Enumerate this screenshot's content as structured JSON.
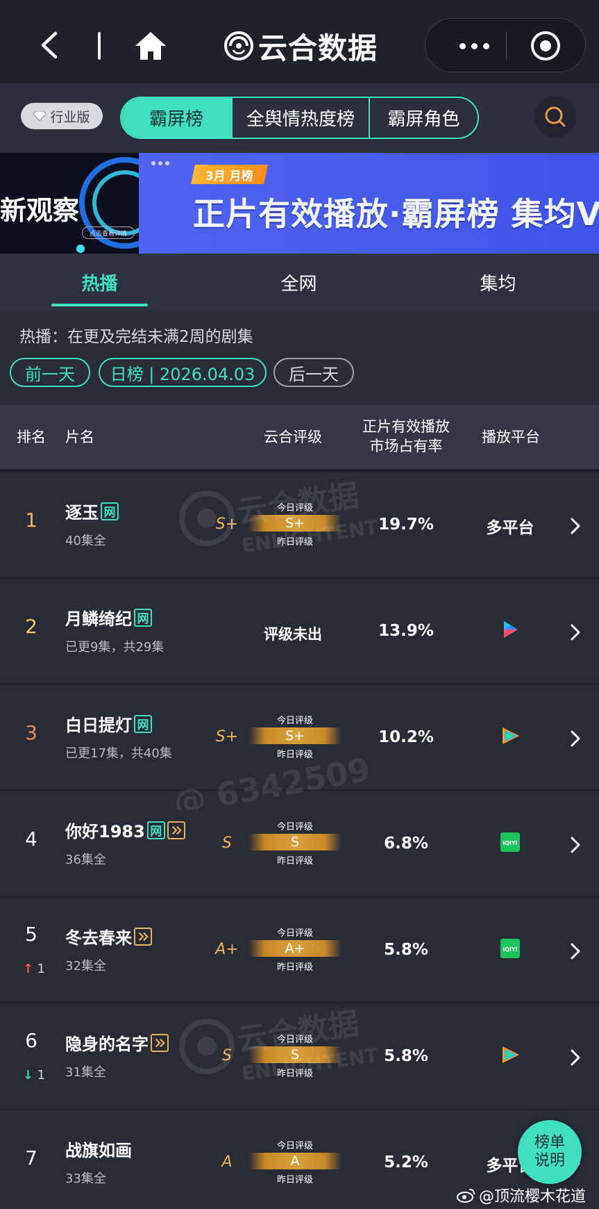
{
  "app": {
    "brand_name": "云合数据"
  },
  "nav": {
    "industry_label": "行业版",
    "segments": [
      "霸屏榜",
      "全舆情热度榜",
      "霸屏角色"
    ],
    "active_segment": 0
  },
  "banner": {
    "left_title": "新观察",
    "left_button": "点击查看详情",
    "tag": "3月 月榜",
    "title": "正片有效播放·霸屏榜 集均V"
  },
  "tabs": [
    "热播",
    "全网",
    "集均"
  ],
  "info": {
    "note": "热播：在更及完结未满2周的剧集",
    "prev_day": "前一天",
    "current_date": "日榜 | 2026.04.03",
    "next_day": "后一天"
  },
  "table": {
    "headers": {
      "rank": "排名",
      "title": "片名",
      "grade": "云合评级",
      "share_line1": "正片有效播放",
      "share_line2": "市场占有率",
      "platform": "播放平台"
    },
    "grade_today_label": "今日评级",
    "grade_yesterday_label": "昨日评级",
    "rows": [
      {
        "rank": "1",
        "title": "逐玉",
        "net": true,
        "play": false,
        "sub": "40集全",
        "grade": "S+",
        "today": "S+",
        "share": "19.7%",
        "platform": "多平台",
        "platform_icon": "",
        "change": "",
        "change_dir": ""
      },
      {
        "rank": "2",
        "title": "月鳞绮纪",
        "net": true,
        "play": false,
        "sub": "已更9集，共29集",
        "grade": "",
        "today": "",
        "grade_none": "评级未出",
        "share": "13.9%",
        "platform": "",
        "platform_icon": "youku-icon",
        "change": "",
        "change_dir": ""
      },
      {
        "rank": "3",
        "title": "白日提灯",
        "net": true,
        "play": false,
        "sub": "已更17集，共40集",
        "grade": "S+",
        "today": "S+",
        "share": "10.2%",
        "platform": "",
        "platform_icon": "tencent-video-icon",
        "change": "",
        "change_dir": ""
      },
      {
        "rank": "4",
        "title": "你好1983",
        "net": true,
        "play": true,
        "sub": "36集全",
        "grade": "S",
        "today": "S",
        "share": "6.8%",
        "platform": "",
        "platform_icon": "iqiyi-icon",
        "change": "",
        "change_dir": ""
      },
      {
        "rank": "5",
        "title": "冬去春来",
        "net": false,
        "play": true,
        "sub": "32集全",
        "grade": "A+",
        "today": "A+",
        "share": "5.8%",
        "platform": "",
        "platform_icon": "iqiyi-icon",
        "change": "1",
        "change_dir": "up"
      },
      {
        "rank": "6",
        "title": "隐身的名字",
        "net": false,
        "play": true,
        "sub": "31集全",
        "grade": "S",
        "today": "S",
        "share": "5.8%",
        "platform": "",
        "platform_icon": "tencent-video-icon",
        "change": "1",
        "change_dir": "down"
      },
      {
        "rank": "7",
        "title": "战旗如画",
        "net": false,
        "play": false,
        "sub": "33集全",
        "grade": "A",
        "today": "A",
        "share": "5.2%",
        "platform": "多平台",
        "platform_icon": "",
        "change": "",
        "change_dir": ""
      }
    ]
  },
  "fab": {
    "line1": "榜单",
    "line2": "说明"
  },
  "watermark": {
    "brand": "云合数据",
    "brand_en": "ENLIGHTENT",
    "handle": "@ 6342509"
  },
  "weibo": "@顶流樱木花道",
  "colors": {
    "accent": "#3fe0c0",
    "gold": "#f0b452",
    "rank1": "#f0b452",
    "rank2": "#f5c75e",
    "rank3": "#e78a5a",
    "up": "#ff5a4a",
    "down": "#3fd49a"
  }
}
